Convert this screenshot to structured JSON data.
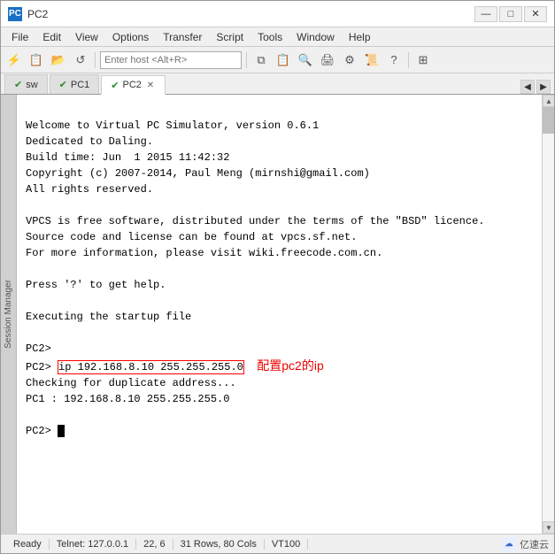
{
  "window": {
    "title": "PC2",
    "icon": "PC"
  },
  "menu": {
    "items": [
      "File",
      "Edit",
      "View",
      "Options",
      "Transfer",
      "Script",
      "Tools",
      "Window",
      "Help"
    ]
  },
  "toolbar": {
    "host_placeholder": "Enter host <Alt+R>"
  },
  "tabs": {
    "items": [
      {
        "label": "sw",
        "active": false,
        "closable": false
      },
      {
        "label": "PC1",
        "active": false,
        "closable": false
      },
      {
        "label": "PC2",
        "active": true,
        "closable": true
      }
    ]
  },
  "side_label": "Session Manager",
  "terminal": {
    "lines": [
      "Welcome to Virtual PC Simulator, version 0.6.1",
      "Dedicated to Daling.",
      "Build time: Jun  1 2015 11:42:32",
      "Copyright (c) 2007-2014, Paul Meng (mirnshi@gmail.com)",
      "All rights reserved.",
      "",
      "VPCS is free software, distributed under the terms of the \"BSD\" licence.",
      "Source code and license can be found at vpcs.sf.net.",
      "For more information, please visit wiki.freecode.com.cn.",
      "",
      "Press '?' to get help.",
      "",
      "Executing the startup file",
      "",
      "PC2>",
      "PC2> ip 192.168.8.10 255.255.255.0",
      "Checking for duplicate address...",
      "PC1 : 192.168.8.10 255.255.255.0",
      "",
      "PC2> "
    ],
    "ip_command": "ip 192.168.8.10 255.255.255.0",
    "annotation": "配置pc2的ip",
    "prompt_line_index": 15
  },
  "status_bar": {
    "ready": "Ready",
    "telnet": "Telnet: 127.0.0.1",
    "position": "22, 6",
    "dimensions": "31 Rows, 80 Cols",
    "encoding": "VT100"
  },
  "brand": {
    "name": "亿速云",
    "icon": "☁"
  },
  "controls": {
    "minimize": "—",
    "maximize": "□",
    "close": "✕"
  }
}
